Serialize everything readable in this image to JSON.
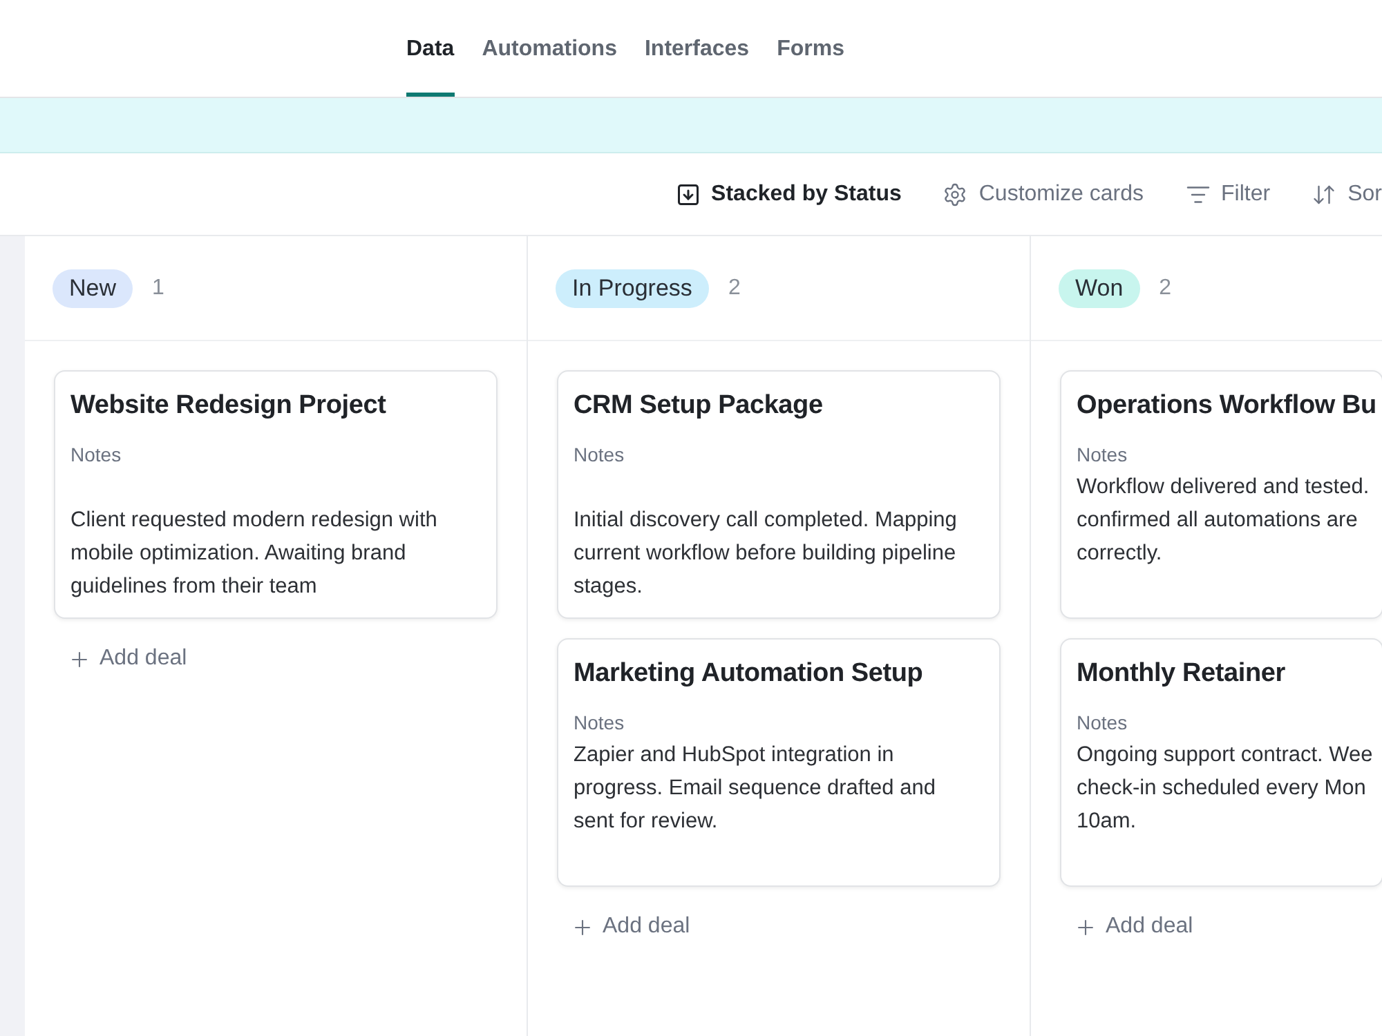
{
  "tabs": [
    {
      "label": "Data",
      "selected": true
    },
    {
      "label": "Automations",
      "selected": false
    },
    {
      "label": "Interfaces",
      "selected": false
    },
    {
      "label": "Forms",
      "selected": false
    }
  ],
  "toolbar": [
    {
      "label": "Stacked by Status",
      "active": true
    },
    {
      "label": "Customize cards",
      "active": false
    },
    {
      "label": "Filter",
      "active": false
    },
    {
      "label": "Sor",
      "active": false
    }
  ],
  "columns": [
    {
      "status": "New",
      "color": "#dbe7fc",
      "count": "1",
      "cards": [
        {
          "title": "Website Redesign Project",
          "notes_label": "Notes",
          "blank_line_before_notes": true,
          "notes": [
            "Client requested modern redesign with",
            "mobile optimization. Awaiting brand",
            "guidelines from their team"
          ]
        }
      ],
      "add_label": "Add deal"
    },
    {
      "status": "In Progress",
      "color": "#cdeefc",
      "count": "2",
      "cards": [
        {
          "title": "CRM Setup Package",
          "notes_label": "Notes",
          "blank_line_before_notes": true,
          "notes": [
            "Initial discovery call completed. Mapping",
            "current workflow before building pipeline",
            "stages."
          ]
        },
        {
          "title": "Marketing Automation Setup",
          "notes_label": "Notes",
          "blank_line_before_notes": false,
          "notes": [
            "Zapier and HubSpot integration in",
            "progress. Email sequence drafted and",
            "sent for review."
          ]
        }
      ],
      "add_label": "Add deal"
    },
    {
      "status": "Won",
      "color": "#c8f5ee",
      "count": "2",
      "cards": [
        {
          "title": "Operations Workflow Bu",
          "notes_label": "Notes",
          "blank_line_before_notes": false,
          "notes": [
            "Workflow delivered and tested.",
            "confirmed all automations are",
            "correctly."
          ]
        },
        {
          "title": "Monthly Retainer",
          "notes_label": "Notes",
          "blank_line_before_notes": false,
          "notes": [
            "Ongoing support contract. Wee",
            "check-in scheduled every Mon",
            "10am."
          ]
        }
      ],
      "add_label": "Add deal"
    }
  ]
}
